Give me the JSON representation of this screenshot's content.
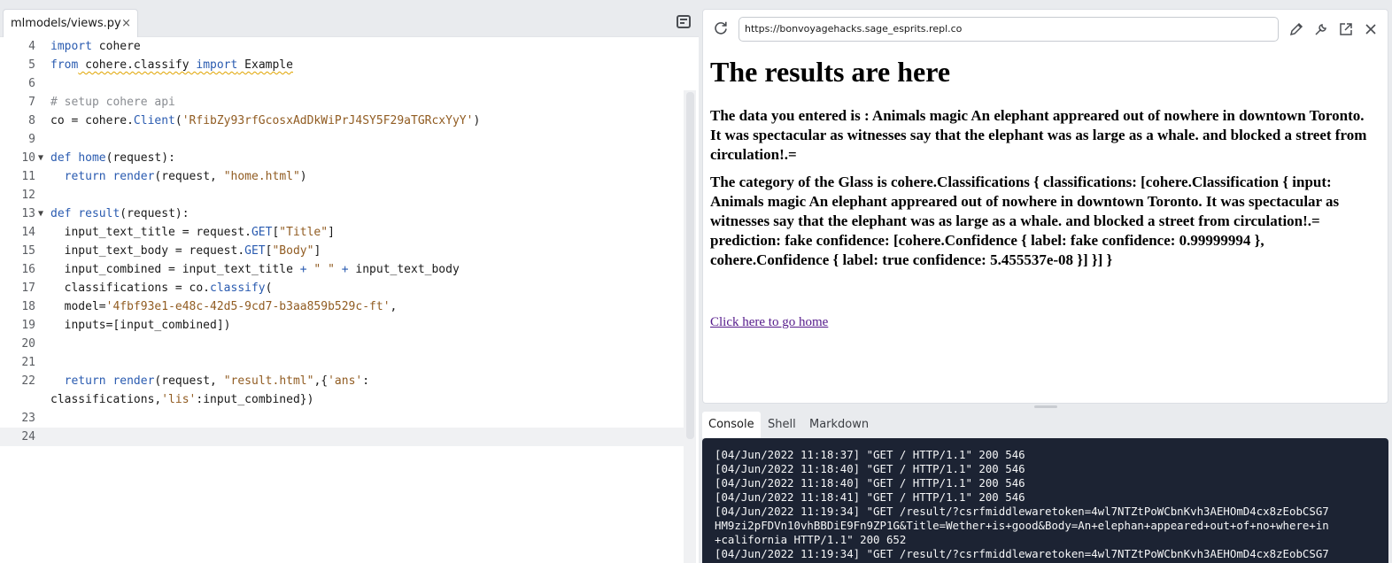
{
  "editor": {
    "tab_title": "mlmodels/views.py",
    "tab_close": "×",
    "lines": [
      {
        "n": "4",
        "tokens": [
          {
            "t": "import",
            "c": "kw"
          },
          {
            "t": " cohere",
            "c": ""
          }
        ]
      },
      {
        "n": "5",
        "tokens": [
          {
            "t": "from",
            "c": "kw"
          },
          {
            "t": " cohere.classify ",
            "c": "sq"
          },
          {
            "t": "import",
            "c": "kwsq"
          },
          {
            "t": " Example",
            "c": "sq"
          }
        ]
      },
      {
        "n": "6",
        "tokens": []
      },
      {
        "n": "7",
        "tokens": [
          {
            "t": "# setup cohere api",
            "c": "cm"
          }
        ]
      },
      {
        "n": "8",
        "tokens": [
          {
            "t": "co = cohere.",
            "c": ""
          },
          {
            "t": "Client",
            "c": "fn"
          },
          {
            "t": "(",
            "c": ""
          },
          {
            "t": "'RfibZy93rfGcosxAdDkWiPrJ4SY5F29aTGRcxYyY'",
            "c": "str"
          },
          {
            "t": ")",
            "c": ""
          }
        ]
      },
      {
        "n": "9",
        "tokens": []
      },
      {
        "n": "10",
        "fold": true,
        "tokens": [
          {
            "t": "def",
            "c": "kw"
          },
          {
            "t": " ",
            "c": ""
          },
          {
            "t": "home",
            "c": "fn"
          },
          {
            "t": "(request):",
            "c": ""
          }
        ]
      },
      {
        "n": "11",
        "tokens": [
          {
            "t": "  ",
            "c": ""
          },
          {
            "t": "return",
            "c": "kw"
          },
          {
            "t": " ",
            "c": ""
          },
          {
            "t": "render",
            "c": "fn"
          },
          {
            "t": "(request, ",
            "c": ""
          },
          {
            "t": "\"home.html\"",
            "c": "str"
          },
          {
            "t": ")",
            "c": ""
          }
        ]
      },
      {
        "n": "12",
        "tokens": []
      },
      {
        "n": "13",
        "fold": true,
        "tokens": [
          {
            "t": "def",
            "c": "kw"
          },
          {
            "t": " ",
            "c": ""
          },
          {
            "t": "result",
            "c": "fn"
          },
          {
            "t": "(request):",
            "c": ""
          }
        ]
      },
      {
        "n": "14",
        "tokens": [
          {
            "t": "  input_text_title = request.",
            "c": ""
          },
          {
            "t": "GET",
            "c": "fn"
          },
          {
            "t": "[",
            "c": ""
          },
          {
            "t": "\"Title\"",
            "c": "str"
          },
          {
            "t": "]",
            "c": ""
          }
        ]
      },
      {
        "n": "15",
        "tokens": [
          {
            "t": "  input_text_body = request.",
            "c": ""
          },
          {
            "t": "GET",
            "c": "fn"
          },
          {
            "t": "[",
            "c": ""
          },
          {
            "t": "\"Body\"",
            "c": "str"
          },
          {
            "t": "]",
            "c": ""
          }
        ]
      },
      {
        "n": "16",
        "tokens": [
          {
            "t": "  input_combined = input_text_title ",
            "c": ""
          },
          {
            "t": "+",
            "c": "kw"
          },
          {
            "t": " ",
            "c": ""
          },
          {
            "t": "\" \"",
            "c": "str"
          },
          {
            "t": " ",
            "c": ""
          },
          {
            "t": "+",
            "c": "kw"
          },
          {
            "t": " input_text_body",
            "c": ""
          }
        ]
      },
      {
        "n": "17",
        "tokens": [
          {
            "t": "  classifications = co.",
            "c": ""
          },
          {
            "t": "classify",
            "c": "fn"
          },
          {
            "t": "(",
            "c": ""
          }
        ]
      },
      {
        "n": "18",
        "tokens": [
          {
            "t": "  model=",
            "c": ""
          },
          {
            "t": "'4fbf93e1-e48c-42d5-9cd7-b3aa859b529c-ft'",
            "c": "str"
          },
          {
            "t": ",",
            "c": ""
          }
        ]
      },
      {
        "n": "19",
        "tokens": [
          {
            "t": "  inputs=[input_combined])",
            "c": ""
          }
        ]
      },
      {
        "n": "20",
        "tokens": []
      },
      {
        "n": "21",
        "tokens": []
      },
      {
        "n": "22",
        "tall": true,
        "tokens": [
          {
            "t": "  ",
            "c": ""
          },
          {
            "t": "return",
            "c": "kw"
          },
          {
            "t": " ",
            "c": ""
          },
          {
            "t": "render",
            "c": "fn"
          },
          {
            "t": "(request, ",
            "c": ""
          },
          {
            "t": "\"result.html\"",
            "c": "str"
          },
          {
            "t": ",{",
            "c": ""
          },
          {
            "t": "'ans'",
            "c": "str"
          },
          {
            "t": ":",
            "c": ""
          }
        ],
        "tokens2": [
          {
            "t": "classifications,",
            "c": ""
          },
          {
            "t": "'lis'",
            "c": "str"
          },
          {
            "t": ":input_combined})",
            "c": ""
          }
        ]
      },
      {
        "n": "23",
        "tokens": []
      },
      {
        "n": "24",
        "active": true,
        "tokens": []
      }
    ]
  },
  "webview": {
    "url": "https://bonvoyagehacks.sage_esprits.repl.co",
    "heading": "The results are here",
    "paragraph1": "The data you entered is : Animals magic An elephant appreared out of nowhere in downtown Toronto. It was spectacular as witnesses say that the elephant was as large as a whale. and blocked a street from circulation!.=",
    "paragraph2": "The category of the Glass is cohere.Classifications { classifications: [cohere.Classification { input: Animals magic An elephant appreared out of nowhere in downtown Toronto. It was spectacular as witnesses say that the elephant was as large as a whale. and blocked a street from circulation!.= prediction: fake confidence: [cohere.Confidence { label: fake confidence: 0.99999994 }, cohere.Confidence { label: true confidence: 5.455537e-08 }] }] }",
    "home_link": "Click here to go home"
  },
  "console": {
    "tabs": [
      "Console",
      "Shell",
      "Markdown"
    ],
    "lines": [
      "[04/Jun/2022 11:18:37] \"GET / HTTP/1.1\" 200 546",
      "[04/Jun/2022 11:18:40] \"GET / HTTP/1.1\" 200 546",
      "[04/Jun/2022 11:18:40] \"GET / HTTP/1.1\" 200 546",
      "[04/Jun/2022 11:18:41] \"GET / HTTP/1.1\" 200 546",
      "[04/Jun/2022 11:19:34] \"GET /result/?csrfmiddlewaretoken=4wl7NTZtPoWCbnKvh3AEHOmD4cx8zEobCSG7",
      "HM9zi2pFDVn10vhBBDiE9Fn9ZP1G&Title=Wether+is+good&Body=An+elephan+appeared+out+of+no+where+in",
      "+california HTTP/1.1\" 200 652",
      "[04/Jun/2022 11:19:34] \"GET /result/?csrfmiddlewaretoken=4wl7NTZtPoWCbnKvh3AEHOmD4cx8zEobCSG7"
    ]
  }
}
